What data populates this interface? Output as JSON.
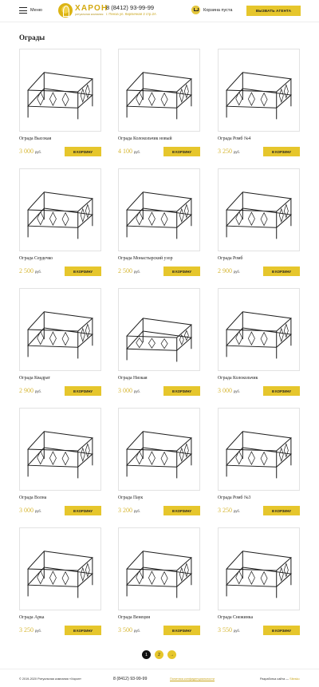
{
  "header": {
    "menu_label": "Меню",
    "logo_name": "ХАРОН",
    "logo_sub": "ритуальная компания",
    "phone": "8 (8412) 93-99-99",
    "address": "г. Пенза ул. Кирпичная 2 стр.2А",
    "cart_label": "Корзина пуста",
    "agent_button": "ВЫЗВАТЬ АГЕНТА"
  },
  "page": {
    "title": "Ограды"
  },
  "buy_label": "В КОРЗИНУ",
  "currency": "руб.",
  "products": [
    {
      "name": "Ограда Высокая",
      "price": "3 000"
    },
    {
      "name": "Ограда Колокольчик новый",
      "price": "4 100"
    },
    {
      "name": "Ограда Ромб №4",
      "price": "3 250"
    },
    {
      "name": "Ограда Сердечко",
      "price": "2 500"
    },
    {
      "name": "Ограда Монастырский узор",
      "price": "2 500"
    },
    {
      "name": "Ограда Ромб",
      "price": "2 900"
    },
    {
      "name": "Ограда Квадрат",
      "price": "2 900"
    },
    {
      "name": "Ограда Низкая",
      "price": "3 000"
    },
    {
      "name": "Ограда Колокольчик",
      "price": "3 000"
    },
    {
      "name": "Ограда Волна",
      "price": "3 000"
    },
    {
      "name": "Ограда Паук",
      "price": "3 200"
    },
    {
      "name": "Ограда Ромб №3",
      "price": "3 250"
    },
    {
      "name": "Ограда Арка",
      "price": "3 250"
    },
    {
      "name": "Ограда Венеция",
      "price": "3 500"
    },
    {
      "name": "Ограда Снежинка",
      "price": "3 550"
    }
  ],
  "pagination": {
    "page1": "1",
    "page2": "2",
    "next": "→"
  },
  "footer": {
    "copyright": "© 2019-2020 Ритуальная компания «Харон»",
    "phone": "8 (8412) 93-99-99",
    "policy": "Политика конфиденциальности",
    "dev_prefix": "Разработка сайта —",
    "dev_link": "Sitesko"
  },
  "colors": {
    "accent": "#e6c62c",
    "price": "#d6b632"
  }
}
